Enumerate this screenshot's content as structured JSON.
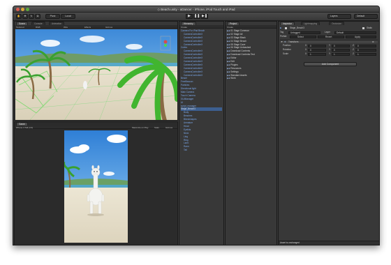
{
  "window": {
    "title": "◇ Beach.unity - aDancer - iPhone, iPod Touch and iPad"
  },
  "toolbar": {
    "pivot_label": "Pivot",
    "local_label": "Local",
    "layers_label": "Layers",
    "layout_label": "Default"
  },
  "scene_panel": {
    "tabs": [
      {
        "label": "Scene"
      },
      {
        "label": "Console"
      },
      {
        "label": "Animation"
      }
    ],
    "bar": [
      "Textured",
      "RGB",
      "Wire",
      "Effects",
      "Gizmos"
    ]
  },
  "game_panel": {
    "tab": "Game",
    "aspect": "iPhone 4 Tall (4:3)",
    "bar_right": [
      "Maximize on Play",
      "Stats",
      "Gizmos"
    ]
  },
  "hierarchy": {
    "tab": "Hierarchy",
    "create_label": "Create",
    "items": [
      "Camera For iPad Beach",
      "CameraControllerX",
      "CameraControllerX",
      "CameraControllerX",
      "CameraControllerX",
      "Cuties",
      "CameraControllerX",
      "CameraControllerX",
      "CameraControllerX",
      "CameraControllerX",
      "CameraControllerX",
      "CameraControllerX",
      "CameraControllerX",
      "CameraControllerX",
      "Beach",
      "FreeBeacon",
      "Particles",
      "Directional light",
      "Main Camera",
      "Touch Camera",
      "GUIManager",
      "UI",
      "script_manager",
      "Stage_Beach3",
      "Body",
      "Beaches",
      "Blendshapes",
      "Armature",
      "Head",
      "Eyelids",
      "Neck",
      "Lleg",
      "Rleg",
      "Larm",
      "Rarm",
      "Tail"
    ],
    "selected_index": 23
  },
  "project": {
    "tab": "Project",
    "create_label": "Create",
    "items": [
      "01 Stage Common",
      "02 Stage All",
      "03 Stage Black",
      "04 Stage Beach",
      "05 Stage Cave",
      "06 Stage Unleashed",
      "Download Contents",
      "Download Contents Test",
      "Editor",
      "Edit",
      "Plugins",
      "Resources",
      "Settings",
      "Standard Assets",
      "Work"
    ]
  },
  "inspector": {
    "tabs": [
      {
        "label": "Inspector"
      },
      {
        "label": "Lightmapping"
      },
      {
        "label": "Occlusion"
      }
    ],
    "object_name": "Stage_Beach3",
    "static_label": "Static",
    "tag_label": "Tag",
    "tag_value": "Untagged",
    "layer_label": "Layer",
    "layer_value": "Default",
    "prefab_label": "Prefab",
    "prefab_buttons": [
      "Select",
      "Revert",
      "Apply"
    ],
    "transform_label": "Transform",
    "rows": [
      {
        "label": "Position",
        "x": "0",
        "y": "0",
        "z": "0"
      },
      {
        "label": "Rotation",
        "x": "0",
        "y": "0",
        "z": "0"
      },
      {
        "label": "Scale",
        "x": "1",
        "y": "1",
        "z": "1"
      }
    ],
    "add_component_label": "Add Component",
    "footer": "Asset is unchanged"
  }
}
